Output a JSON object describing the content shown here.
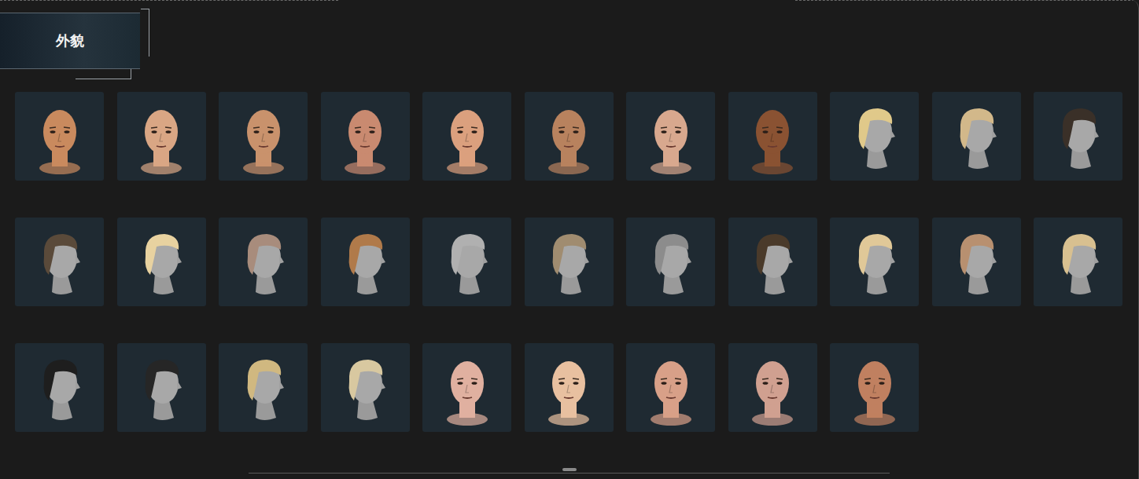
{
  "panel": {
    "title": "外貌"
  },
  "items": [
    {
      "kind": "face",
      "color": "#c98a5e",
      "selected": false
    },
    {
      "kind": "face",
      "color": "#d9a684",
      "selected": false
    },
    {
      "kind": "face",
      "color": "#c9926c",
      "selected": false
    },
    {
      "kind": "face",
      "color": "#c98a70",
      "selected": false
    },
    {
      "kind": "face",
      "color": "#dba07e",
      "selected": false
    },
    {
      "kind": "face",
      "color": "#b8825e",
      "selected": false
    },
    {
      "kind": "face",
      "color": "#d8a88e",
      "selected": false
    },
    {
      "kind": "face",
      "color": "#8a5232",
      "selected": false
    },
    {
      "kind": "hair",
      "color": "#e0c98a",
      "selected": false
    },
    {
      "kind": "hair",
      "color": "#d2b88a",
      "selected": false
    },
    {
      "kind": "hair",
      "color": "#3a3028",
      "selected": false
    },
    {
      "kind": "hair",
      "color": "#5a4a3a",
      "selected": false
    },
    {
      "kind": "hair",
      "color": "#e8d2a0",
      "selected": false
    },
    {
      "kind": "hair",
      "color": "#a88c7c",
      "selected": false
    },
    {
      "kind": "hair",
      "color": "#b07a4a",
      "selected": false
    },
    {
      "kind": "hair",
      "color": "#b0b0b0",
      "selected": false
    },
    {
      "kind": "hair",
      "color": "#a08c70",
      "selected": false
    },
    {
      "kind": "hair",
      "color": "#8c8c8c",
      "selected": false
    },
    {
      "kind": "hair",
      "color": "#4a3a2a",
      "selected": false
    },
    {
      "kind": "hair",
      "color": "#e0c898",
      "selected": false
    },
    {
      "kind": "hair",
      "color": "#b89070",
      "selected": false
    },
    {
      "kind": "hair",
      "color": "#d8c090",
      "selected": false
    },
    {
      "kind": "hair",
      "color": "#1e1e1e",
      "selected": false
    },
    {
      "kind": "hair",
      "color": "#262626",
      "selected": false
    },
    {
      "kind": "hair",
      "color": "#d0b880",
      "selected": false
    },
    {
      "kind": "hair",
      "color": "#d8c8a0",
      "selected": false
    },
    {
      "kind": "face",
      "color": "#e0b0a0",
      "selected": false
    },
    {
      "kind": "face",
      "color": "#e8c0a0",
      "selected": false
    },
    {
      "kind": "face",
      "color": "#d8a088",
      "selected": false
    },
    {
      "kind": "face",
      "color": "#d0a090",
      "selected": false
    },
    {
      "kind": "face",
      "color": "#c08060",
      "selected": false
    }
  ]
}
